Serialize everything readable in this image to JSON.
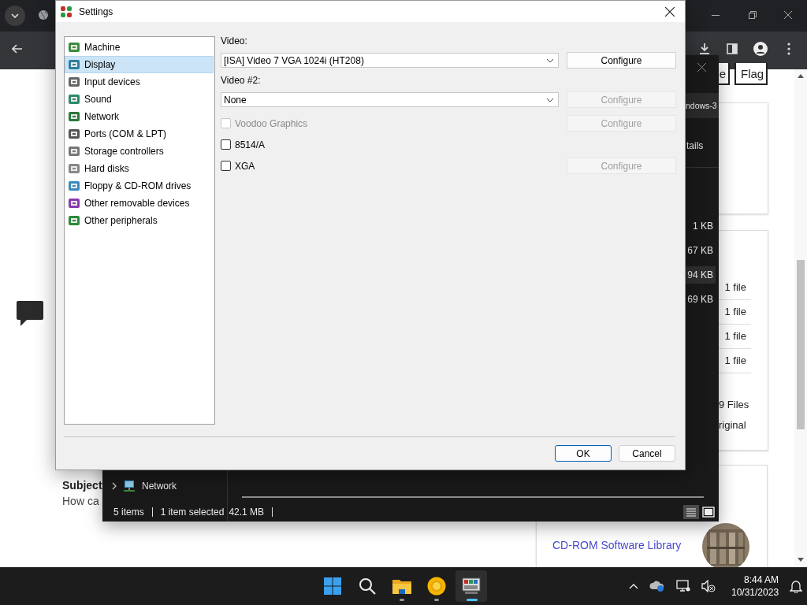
{
  "page": {
    "buttons": [
      "e",
      "Flag"
    ],
    "review_subject": "Subject",
    "review_text": "How ca",
    "file_counts": [
      "1 file",
      "1 file",
      "1 file",
      "1 file"
    ],
    "total_files": "9 Files",
    "original": "riginal",
    "link": "CD-ROM Software Library"
  },
  "explorer": {
    "tab": "ndows-3",
    "details": "tails",
    "sizes": [
      {
        "text": "1 KB",
        "selected": false
      },
      {
        "text": "67 KB",
        "selected": false
      },
      {
        "text": "94 KB",
        "selected": true
      },
      {
        "text": "69 KB",
        "selected": false
      }
    ],
    "nav_item": "Network",
    "status_items": "5 items",
    "status_selected": "1 item selected",
    "status_size": "42.1 MB"
  },
  "dialog": {
    "title": "Settings",
    "categories": [
      {
        "label": "Machine",
        "selected": false
      },
      {
        "label": "Display",
        "selected": true
      },
      {
        "label": "Input devices",
        "selected": false
      },
      {
        "label": "Sound",
        "selected": false
      },
      {
        "label": "Network",
        "selected": false
      },
      {
        "label": "Ports (COM & LPT)",
        "selected": false
      },
      {
        "label": "Storage controllers",
        "selected": false
      },
      {
        "label": "Hard disks",
        "selected": false
      },
      {
        "label": "Floppy & CD-ROM drives",
        "selected": false
      },
      {
        "label": "Other removable devices",
        "selected": false
      },
      {
        "label": "Other peripherals",
        "selected": false
      }
    ],
    "devices": [
      {
        "kind": "combo",
        "label": "Video:",
        "value": "[ISA] Video 7 VGA 1024i (HT208)",
        "configure": {
          "label": "Configure",
          "disabled": false
        }
      },
      {
        "kind": "combo",
        "label": "Video #2:",
        "value": "None",
        "configure": {
          "label": "Configure",
          "disabled": true
        }
      },
      {
        "kind": "check",
        "label": "Voodoo Graphics",
        "checked": false,
        "disabled": true,
        "configure": {
          "label": "Configure",
          "disabled": true
        }
      },
      {
        "kind": "check",
        "label": "8514/A",
        "checked": false,
        "disabled": false
      },
      {
        "kind": "check",
        "label": "XGA",
        "checked": false,
        "disabled": false,
        "configure": {
          "label": "Configure",
          "disabled": true
        }
      }
    ],
    "ok": "OK",
    "cancel": "Cancel"
  },
  "taskbar": {
    "apps": [
      {
        "kind": "start",
        "running": false,
        "active": false
      },
      {
        "kind": "search",
        "running": false,
        "active": false
      },
      {
        "kind": "folder",
        "running": true,
        "active": false
      },
      {
        "kind": "ring",
        "running": true,
        "active": false
      },
      {
        "kind": "emulator",
        "running": true,
        "active": true
      }
    ],
    "time": "8:44 AM",
    "date": "10/31/2023"
  }
}
